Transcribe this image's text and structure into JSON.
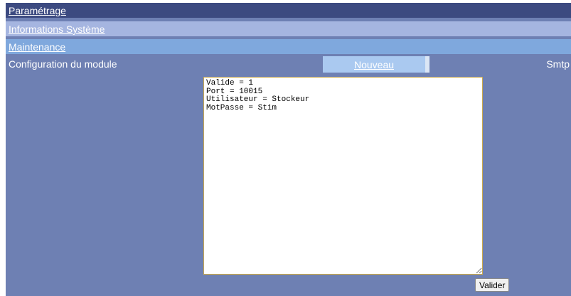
{
  "nav": {
    "parametrage": "Paramétrage",
    "informations_systeme": "Informations Système",
    "maintenance": "Maintenance"
  },
  "module": {
    "title": "Configuration du module",
    "new_tab": "Nouveau",
    "module_name": "Smtp"
  },
  "editor": {
    "content": "Valide = 1\nPort = 10015\nUtilisateur = Stockeur\nMotPasse = Stim"
  },
  "actions": {
    "validate_label": "Valider"
  }
}
